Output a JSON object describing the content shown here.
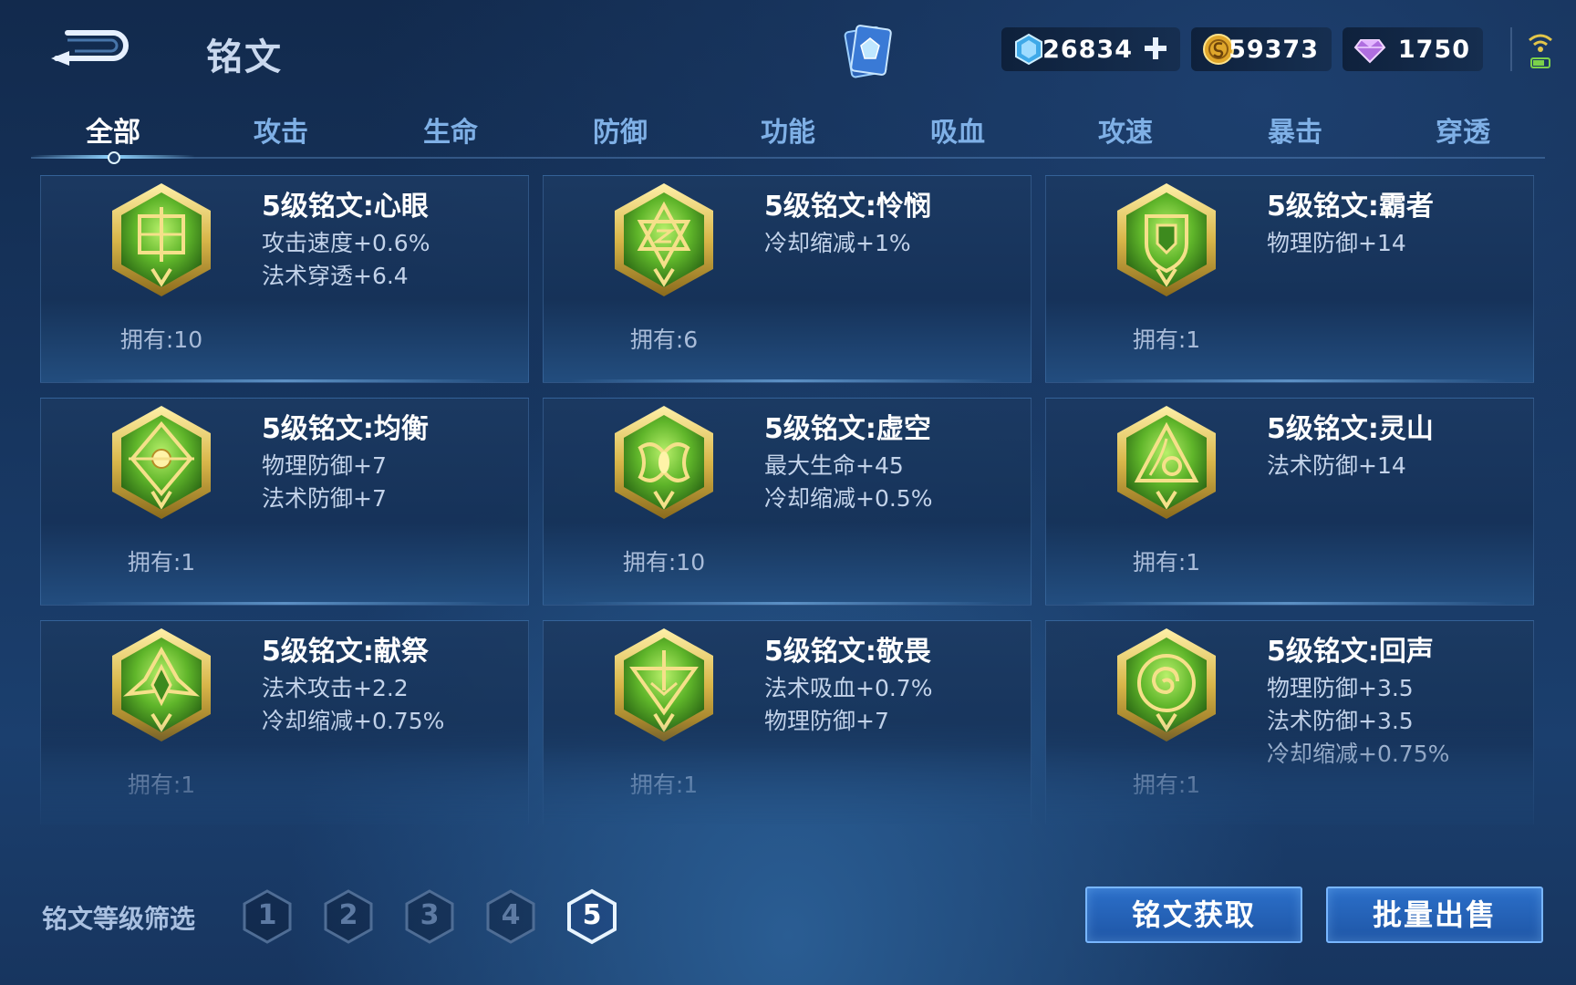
{
  "header": {
    "title": "铭文",
    "currencies": {
      "crystal": "26834",
      "gold": "59373",
      "diamond": "1750"
    }
  },
  "tabs": [
    "全部",
    "攻击",
    "生命",
    "防御",
    "功能",
    "吸血",
    "攻速",
    "暴击",
    "穿透"
  ],
  "active_tab": "全部",
  "runes": [
    {
      "name": "5级铭文:心眼",
      "stats": [
        "攻击速度+0.6%",
        "法术穿透+6.4"
      ],
      "owned": "拥有:10",
      "icon": "rune-xinyan-icon"
    },
    {
      "name": "5级铭文:怜悯",
      "stats": [
        "冷却缩减+1%"
      ],
      "owned": "拥有:6",
      "icon": "rune-lianmin-icon"
    },
    {
      "name": "5级铭文:霸者",
      "stats": [
        "物理防御+14"
      ],
      "owned": "拥有:1",
      "icon": "rune-bazhe-icon"
    },
    {
      "name": "5级铭文:均衡",
      "stats": [
        "物理防御+7",
        "法术防御+7"
      ],
      "owned": "拥有:1",
      "icon": "rune-junheng-icon"
    },
    {
      "name": "5级铭文:虚空",
      "stats": [
        "最大生命+45",
        "冷却缩减+0.5%"
      ],
      "owned": "拥有:10",
      "icon": "rune-xukong-icon"
    },
    {
      "name": "5级铭文:灵山",
      "stats": [
        "法术防御+14"
      ],
      "owned": "拥有:1",
      "icon": "rune-lingshan-icon"
    },
    {
      "name": "5级铭文:献祭",
      "stats": [
        "法术攻击+2.2",
        "冷却缩减+0.75%"
      ],
      "owned": "拥有:1",
      "icon": "rune-xianji-icon"
    },
    {
      "name": "5级铭文:敬畏",
      "stats": [
        "法术吸血+0.7%",
        "物理防御+7"
      ],
      "owned": "拥有:1",
      "icon": "rune-jingwei-icon"
    },
    {
      "name": "5级铭文:回声",
      "stats": [
        "物理防御+3.5",
        "法术防御+3.5",
        "冷却缩减+0.75%"
      ],
      "owned": "拥有:1",
      "icon": "rune-huisheng-icon"
    }
  ],
  "footer": {
    "filter_label": "铭文等级筛选",
    "levels": [
      "1",
      "2",
      "3",
      "4",
      "5"
    ],
    "active_level": "5",
    "get_button": "铭文获取",
    "sell_button": "批量出售"
  },
  "colors": {
    "rune_gold": "#d8b64a",
    "rune_green": "#6fc92e",
    "accent_blue": "#78b6ff",
    "tab_inactive": "#7fb0e6"
  }
}
